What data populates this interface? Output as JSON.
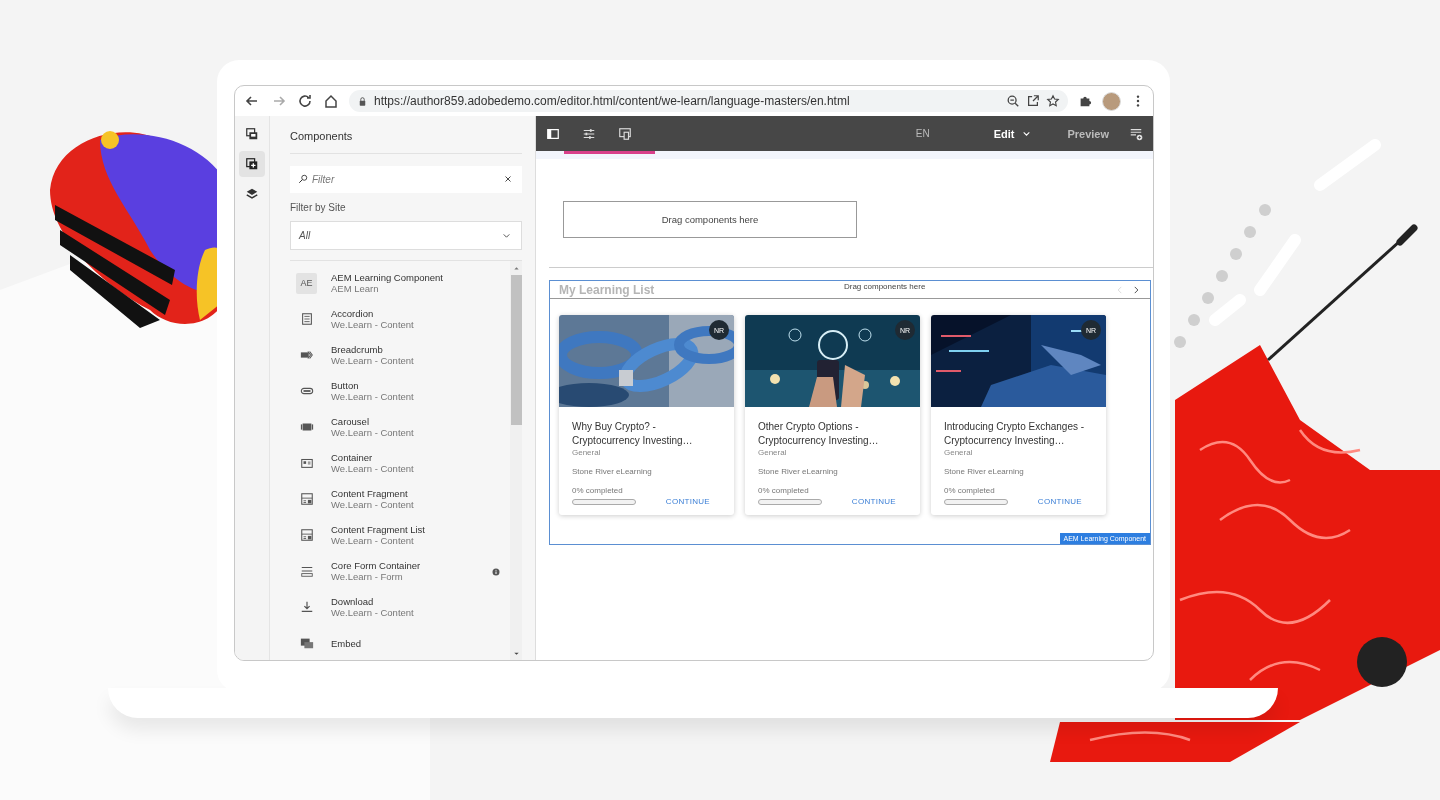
{
  "browser": {
    "url": "https://author859.adobedemo.com/editor.html/content/we-learn/language-masters/en.html"
  },
  "side_rail": [
    {
      "kind": "assets",
      "selected": false
    },
    {
      "kind": "components",
      "selected": true
    },
    {
      "kind": "layers",
      "selected": false
    }
  ],
  "panel": {
    "title": "Components",
    "filter_placeholder": "Filter",
    "site_label": "Filter by Site",
    "site_value": "All",
    "components": [
      {
        "kind": "text",
        "icon_text": "AE",
        "name": "AEM Learning Component",
        "site": "AEM Learn",
        "info": false
      },
      {
        "kind": "accordion",
        "name": "Accordion",
        "site": "We.Learn - Content",
        "info": false
      },
      {
        "kind": "breadcrumb",
        "name": "Breadcrumb",
        "site": "We.Learn - Content",
        "info": false
      },
      {
        "kind": "button",
        "name": "Button",
        "site": "We.Learn - Content",
        "info": false
      },
      {
        "kind": "carousel",
        "name": "Carousel",
        "site": "We.Learn - Content",
        "info": false
      },
      {
        "kind": "container",
        "name": "Container",
        "site": "We.Learn - Content",
        "info": false
      },
      {
        "kind": "fragment",
        "name": "Content Fragment",
        "site": "We.Learn - Content",
        "info": false
      },
      {
        "kind": "fragment",
        "name": "Content Fragment List",
        "site": "We.Learn - Content",
        "info": false
      },
      {
        "kind": "form",
        "name": "Core Form Container",
        "site": "We.Learn - Form",
        "info": true
      },
      {
        "kind": "download",
        "name": "Download",
        "site": "We.Learn - Content",
        "info": false
      },
      {
        "kind": "embed",
        "name": "Embed",
        "info": false
      }
    ]
  },
  "editor": {
    "toolbar": {
      "language": "EN",
      "mode": "Edit",
      "preview": "Preview"
    },
    "drop_zone": "Drag components here",
    "learning_list": {
      "title": "My Learning List",
      "drop_hint": "Drag components here",
      "component_label": "AEM Learning Component",
      "cards": [
        {
          "kind": "picture",
          "badge": "NR",
          "title": "Why Buy Crypto? - Cryptocurrency Investing…",
          "category": "General",
          "author": "Stone River eLearning",
          "progress": "0% completed",
          "level": 0,
          "action": "CONTINUE"
        },
        {
          "kind": "picture",
          "badge": "NR",
          "title": "Other Crypto Options - Cryptocurrency Investing…",
          "category": "General",
          "author": "Stone River eLearning",
          "progress": "0% completed",
          "level": 0,
          "action": "CONTINUE"
        },
        {
          "kind": "picture",
          "badge": "NR",
          "title": "Introducing Crypto Exchanges - Cryptocurrency Investing…",
          "category": "General",
          "author": "Stone River eLearning",
          "progress": "0% completed",
          "level": 0,
          "action": "CONTINUE"
        }
      ]
    }
  }
}
